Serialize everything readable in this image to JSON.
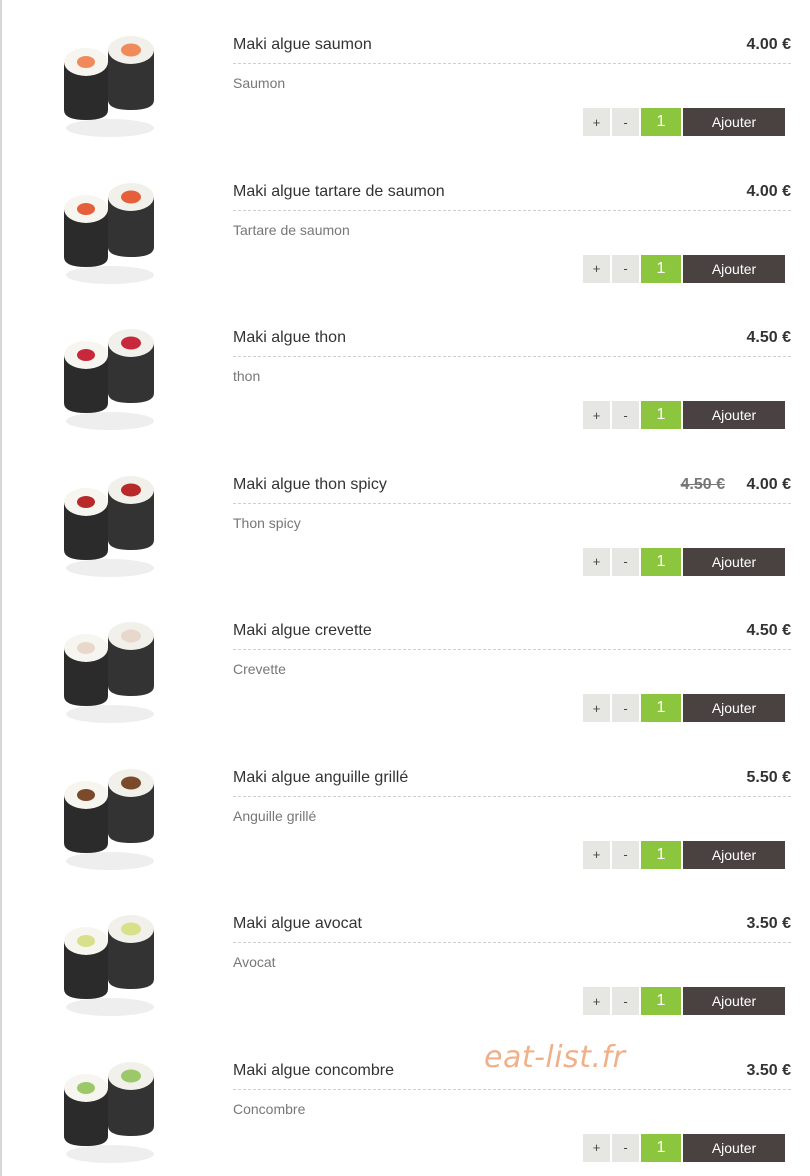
{
  "menu": {
    "items": [
      {
        "name": "Maki algue saumon",
        "desc": "Saumon",
        "price": "4.00 €",
        "old_price": "",
        "qty": "1",
        "plus": "+",
        "minus": "-",
        "add": "Ajouter",
        "filling": "#f08a5a"
      },
      {
        "name": "Maki algue tartare de saumon",
        "desc": "Tartare de saumon",
        "price": "4.00 €",
        "old_price": "",
        "qty": "1",
        "plus": "+",
        "minus": "-",
        "add": "Ajouter",
        "filling": "#e5603a"
      },
      {
        "name": "Maki algue thon",
        "desc": "thon",
        "price": "4.50 €",
        "old_price": "",
        "qty": "1",
        "plus": "+",
        "minus": "-",
        "add": "Ajouter",
        "filling": "#c8283c"
      },
      {
        "name": "Maki algue thon spicy",
        "desc": "Thon spicy",
        "price": "4.00 €",
        "old_price": "4.50 €",
        "qty": "1",
        "plus": "+",
        "minus": "-",
        "add": "Ajouter",
        "filling": "#b82a2a"
      },
      {
        "name": "Maki algue crevette",
        "desc": "Crevette",
        "price": "4.50 €",
        "old_price": "",
        "qty": "1",
        "plus": "+",
        "minus": "-",
        "add": "Ajouter",
        "filling": "#e8d8cc"
      },
      {
        "name": "Maki algue anguille grillé",
        "desc": "Anguille grillé",
        "price": "5.50 €",
        "old_price": "",
        "qty": "1",
        "plus": "+",
        "minus": "-",
        "add": "Ajouter",
        "filling": "#7a4a2a"
      },
      {
        "name": "Maki algue avocat",
        "desc": "Avocat",
        "price": "3.50 €",
        "old_price": "",
        "qty": "1",
        "plus": "+",
        "minus": "-",
        "add": "Ajouter",
        "filling": "#d8e08a"
      },
      {
        "name": "Maki algue concombre",
        "desc": "Concombre",
        "price": "3.50 €",
        "old_price": "",
        "qty": "1",
        "plus": "+",
        "minus": "-",
        "add": "Ajouter",
        "filling": "#9cc86a"
      }
    ]
  },
  "watermark": "eat-list.fr",
  "colors": {
    "qty_bg": "#8cc63f",
    "add_bg": "#4a4240",
    "step_bg": "#e6e6e2"
  }
}
